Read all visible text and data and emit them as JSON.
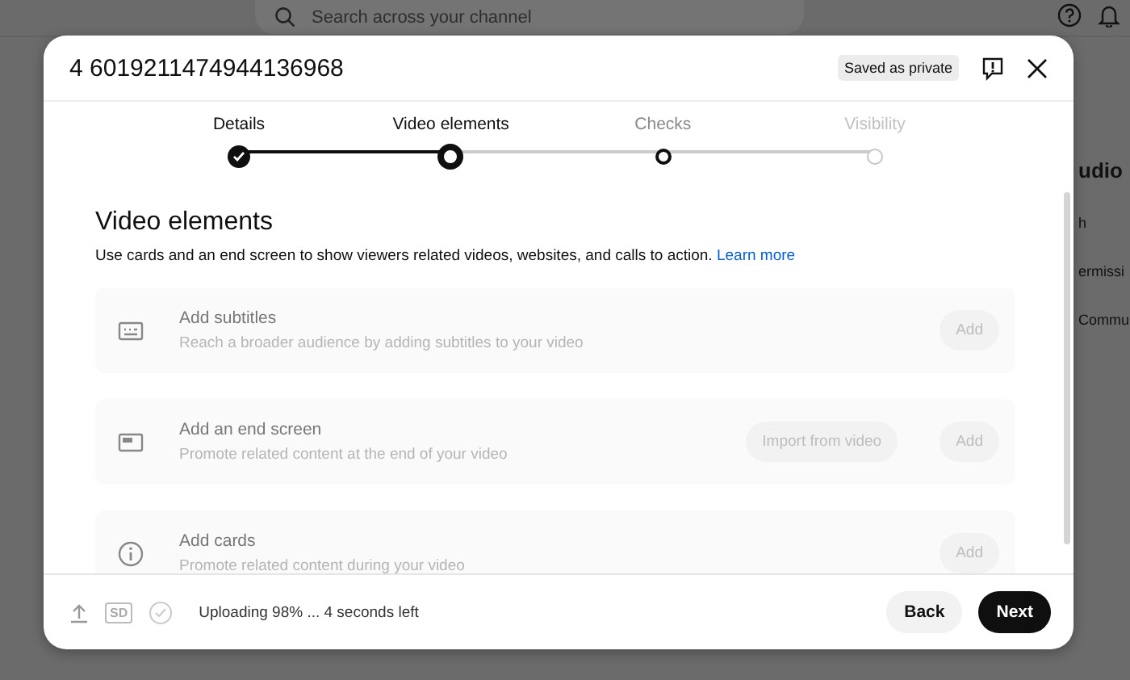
{
  "background": {
    "search": {
      "placeholder": "Search across your channel"
    },
    "side_texts": [
      {
        "text": "udio",
        "kind": "heading"
      },
      {
        "text": "h",
        "kind": "item"
      },
      {
        "text": "ermissi",
        "kind": "item"
      },
      {
        "text": "Commu",
        "kind": "item"
      }
    ]
  },
  "dialog": {
    "title": "4 6019211474944136968",
    "badge": "Saved as private",
    "steps": [
      {
        "label": "Details",
        "completed": true,
        "selected": false,
        "disabled": false
      },
      {
        "label": "Video elements",
        "completed": false,
        "selected": true,
        "disabled": false
      },
      {
        "label": "Checks",
        "completed": false,
        "selected": false,
        "disabled": false
      },
      {
        "label": "Visibility",
        "completed": false,
        "selected": false,
        "disabled": true
      }
    ],
    "heading": "Video elements",
    "description": "Use cards and an end screen to show viewers related videos, websites, and calls to action.",
    "link": "Learn more",
    "cards": [
      {
        "kind": "subtitles",
        "title": "Add subtitles",
        "subtitle": "Reach a broader audience by adding subtitles to your video",
        "disabled": true,
        "buttons": [
          "Add"
        ]
      },
      {
        "kind": "endscreen",
        "title": "Add an end screen",
        "subtitle": "Promote related content at the end of your video",
        "disabled": true,
        "buttons": [
          "Import from video",
          "Add"
        ]
      },
      {
        "kind": "cards",
        "title": "Add cards",
        "subtitle": "Promote related content during your video",
        "disabled": true,
        "buttons": [
          "Add"
        ]
      }
    ],
    "footer": {
      "quality": "SD",
      "status": "Uploading 98% ... 4 seconds left",
      "back": "Back",
      "next": "Next"
    }
  }
}
